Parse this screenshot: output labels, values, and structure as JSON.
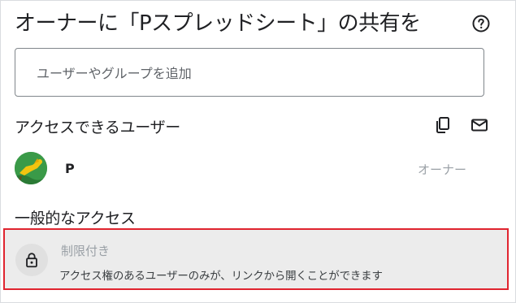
{
  "dialog": {
    "title": "オーナーに「Pスプレッドシート」の共有を",
    "help_icon": "help-circle-icon"
  },
  "search": {
    "placeholder": "ユーザーやグループを追加",
    "value": ""
  },
  "people_section": {
    "label": "アクセスできるユーザー",
    "copy_icon": "copy-link-icon",
    "email_icon": "email-icon",
    "users": [
      {
        "name": "P",
        "role": "オーナー",
        "avatar_icon": "user-avatar"
      }
    ]
  },
  "general_access": {
    "label": "一般的なアクセス",
    "icon": "lock-icon",
    "level": "制限付き",
    "description": "アクセス権のあるユーザーのみが、リンクから開くことができます"
  },
  "colors": {
    "highlight_border": "#e0242f",
    "access_bg": "#ececec",
    "muted_text": "#9aa0a6"
  }
}
